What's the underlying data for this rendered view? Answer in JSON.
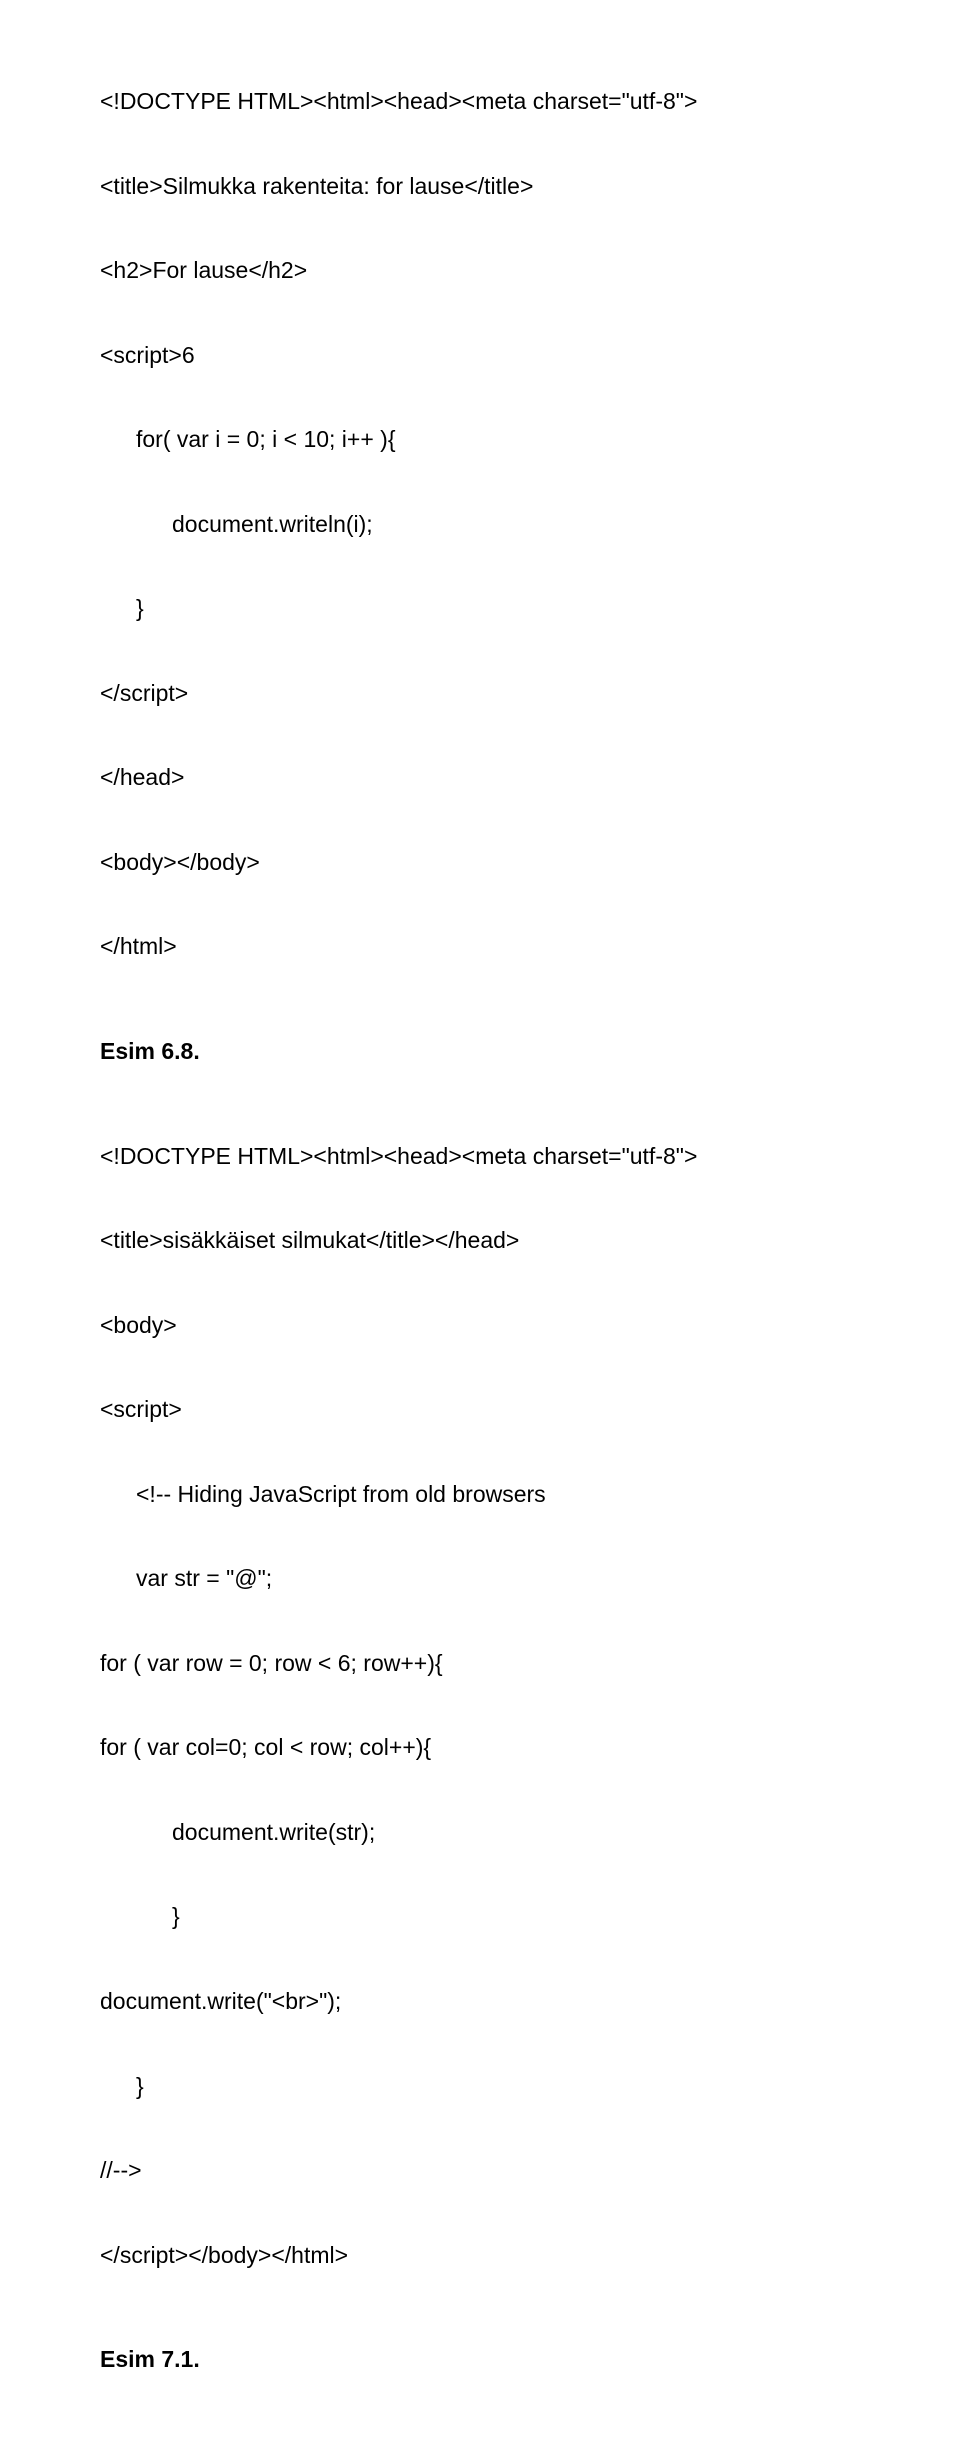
{
  "lines": [
    {
      "text": "<!DOCTYPE HTML><html><head><meta charset=\"utf-8\">",
      "cls": ""
    },
    {
      "spacer": "spacer-md"
    },
    {
      "text": "<title>Silmukka rakenteita: for lause</title>",
      "cls": ""
    },
    {
      "spacer": "spacer-md"
    },
    {
      "text": "<h2>For lause</h2>",
      "cls": ""
    },
    {
      "spacer": "spacer-md"
    },
    {
      "text": "<script>6",
      "cls": ""
    },
    {
      "spacer": "spacer-md"
    },
    {
      "text": "for( var i = 0; i < 10; i++ ){",
      "cls": "indent1"
    },
    {
      "spacer": "spacer-md"
    },
    {
      "text": "document.writeln(i);",
      "cls": "indent2"
    },
    {
      "spacer": "spacer-md"
    },
    {
      "text": "}",
      "cls": "indent1"
    },
    {
      "spacer": "spacer-md"
    },
    {
      "text": "</script>",
      "cls": ""
    },
    {
      "spacer": "spacer-md"
    },
    {
      "text": "</head>",
      "cls": ""
    },
    {
      "spacer": "spacer-md"
    },
    {
      "text": "<body></body>",
      "cls": ""
    },
    {
      "spacer": "spacer-md"
    },
    {
      "text": "</html>",
      "cls": ""
    },
    {
      "spacer": "spacer-xl"
    },
    {
      "text": "Esim 6.8.",
      "cls": "bold"
    },
    {
      "spacer": "spacer-xl"
    },
    {
      "text": "<!DOCTYPE HTML><html><head><meta charset=\"utf-8\">",
      "cls": ""
    },
    {
      "spacer": "spacer-md"
    },
    {
      "text": "<title>sisäkkäiset silmukat</title></head>",
      "cls": ""
    },
    {
      "spacer": "spacer-md"
    },
    {
      "text": "<body>",
      "cls": ""
    },
    {
      "spacer": "spacer-md"
    },
    {
      "text": "<script>",
      "cls": ""
    },
    {
      "spacer": "spacer-md"
    },
    {
      "text": "<!-- Hiding JavaScript from old browsers",
      "cls": "indent1"
    },
    {
      "spacer": "spacer-md"
    },
    {
      "text": "var str = \"@\";",
      "cls": "indent1"
    },
    {
      "spacer": "spacer-md"
    },
    {
      "text": "for ( var row = 0; row < 6; row++){",
      "cls": ""
    },
    {
      "spacer": "spacer-md"
    },
    {
      "text": "for ( var col=0; col < row; col++){",
      "cls": ""
    },
    {
      "spacer": "spacer-md"
    },
    {
      "text": "document.write(str);",
      "cls": "indent2"
    },
    {
      "spacer": "spacer-md"
    },
    {
      "text": "}",
      "cls": "indent2"
    },
    {
      "spacer": "spacer-md"
    },
    {
      "text": "document.write(\"<br>\");",
      "cls": ""
    },
    {
      "spacer": "spacer-md"
    },
    {
      "text": "}",
      "cls": "indent1"
    },
    {
      "spacer": "spacer-md"
    },
    {
      "text": "//-->",
      "cls": ""
    },
    {
      "spacer": "spacer-md"
    },
    {
      "text": "</script></body></html>",
      "cls": ""
    },
    {
      "spacer": "spacer-xl"
    },
    {
      "text": "Esim 7.1.",
      "cls": "bold"
    }
  ]
}
